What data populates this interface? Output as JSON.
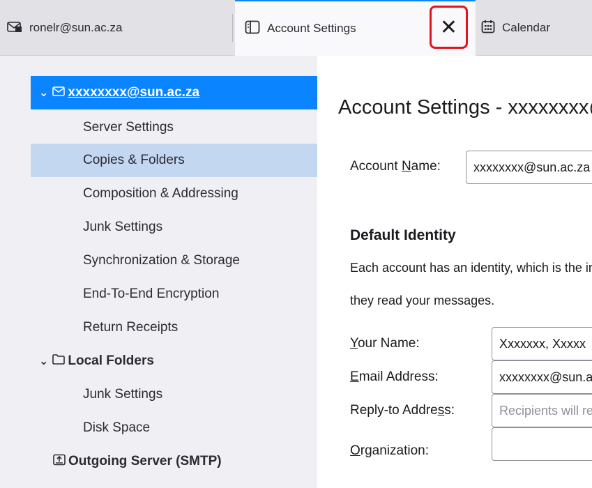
{
  "tabs": {
    "mail_label": "ronelr@sun.ac.za",
    "settings_label": "Account Settings",
    "calendar_label": "Calendar",
    "close_glyph": "✕",
    "active_color": "#0a84ff",
    "close_highlight_color": "#e0141e"
  },
  "sidebar": {
    "account_label": "xxxxxxxx@sun.ac.za",
    "account_items": [
      "Server Settings",
      "Copies & Folders",
      "Composition & Addressing",
      "Junk Settings",
      "Synchronization & Storage",
      "End-To-End Encryption",
      "Return Receipts"
    ],
    "local_folders_label": "Local Folders",
    "local_items": [
      "Junk Settings",
      "Disk Space"
    ],
    "outgoing_label": "Outgoing Server (SMTP)",
    "selected_color": "#0a84ff"
  },
  "main": {
    "title": "Account Settings - xxxxxxxx@sun.ac.za",
    "account_name_label_pre": "Account ",
    "account_name_label_key": "N",
    "account_name_label_post": "ame:",
    "account_name_value": "xxxxxxxx@sun.ac.za",
    "default_identity_title": "Default Identity",
    "desc_line1": "Each account has an identity, which is the information that other people see when",
    "desc_line2": "they read your messages.",
    "your_name_key": "Y",
    "your_name_label": "our Name:",
    "your_name_value": "Xxxxxxx, Xxxxx",
    "email_key": "E",
    "email_label": "mail Address:",
    "email_value": "xxxxxxxx@sun.ac.za",
    "reply_pre": "Reply-to Addre",
    "reply_key": "s",
    "reply_post": "s:",
    "reply_placeholder": "Recipients will reply to this other address",
    "org_key": "O",
    "org_label": "rganization:",
    "org_value": ""
  }
}
